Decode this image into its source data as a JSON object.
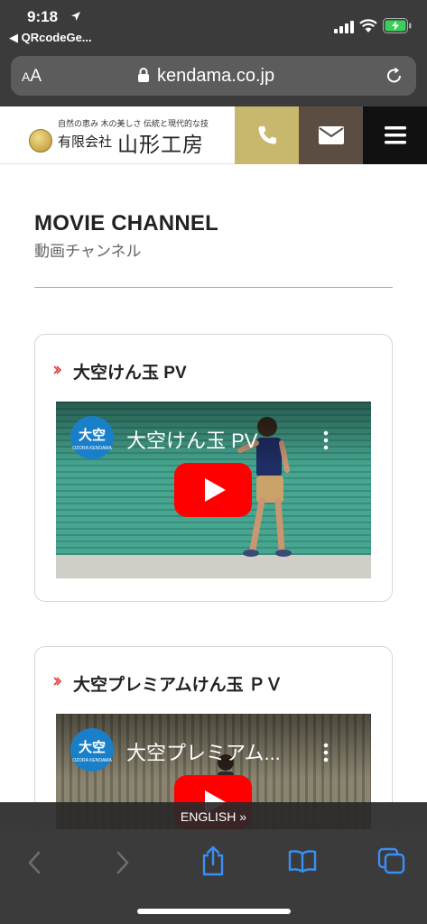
{
  "status_bar": {
    "time": "9:18",
    "back_app": "◀ QRcodeGe..."
  },
  "address_bar": {
    "text_size_label_small": "A",
    "text_size_label_large": "A",
    "url": "kendama.co.jp"
  },
  "site_header": {
    "tagline": "自然の恵み 木の美しさ 伝統と現代的な技",
    "company_type": "有限会社",
    "company_name": "山形工房"
  },
  "section": {
    "title": "MOVIE CHANNEL",
    "subtitle": "動画チャンネル"
  },
  "videos": [
    {
      "card_title": "大空けん玉 PV",
      "player_title": "大空けん玉 PV",
      "channel_logo_text": "大空",
      "channel_logo_sub": "OZORA KENDAMA"
    },
    {
      "card_title": "大空プレミアムけん玉 ＰＶ",
      "player_title": "大空プレミアム...",
      "channel_logo_text": "大空",
      "channel_logo_sub": "OZORA KENDAMA"
    }
  ],
  "language_switch": "ENGLISH »",
  "toolbar": {
    "buttons": [
      "back-icon",
      "forward-icon",
      "share-icon",
      "bookmarks-icon",
      "tabs-icon"
    ]
  },
  "colors": {
    "phone_button": "#c8b86e",
    "mail_button": "#5b4d42",
    "menu_button": "#111111",
    "play_button": "#ff0000",
    "safari_blue": "#3a8ff7",
    "accent_red": "#e23b3b"
  }
}
